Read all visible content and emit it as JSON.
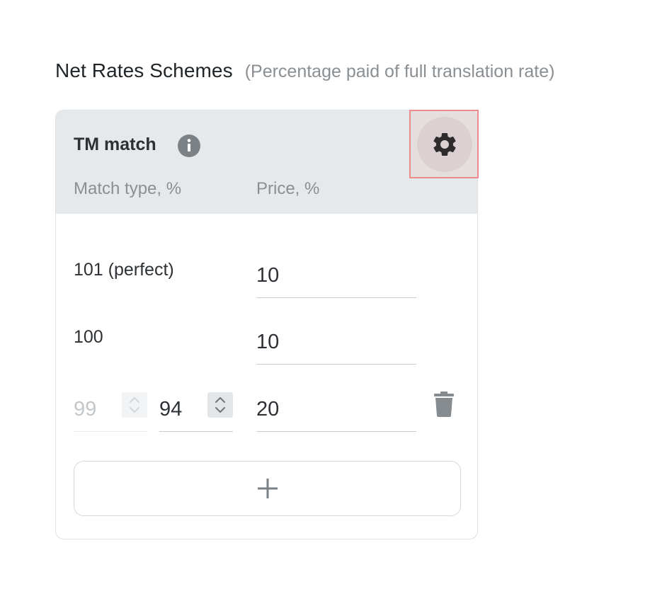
{
  "heading": {
    "title": "Net Rates Schemes",
    "subtitle": "(Percentage paid of full translation rate)"
  },
  "card": {
    "title": "TM match",
    "info_icon": "info-icon",
    "settings_icon": "gear-icon",
    "columns": {
      "match_type": "Match type, %",
      "price": "Price, %"
    },
    "rows": [
      {
        "label": "101 (perfect)",
        "price": "10"
      },
      {
        "label": "100",
        "price": "10"
      },
      {
        "range_from": "99",
        "range_to": "94",
        "price": "20",
        "delete_icon": "trash-icon"
      }
    ],
    "add_icon": "plus-icon"
  },
  "colors": {
    "header_bg": "#e5e9eb",
    "text": "#2d3135",
    "muted": "#8a8f93",
    "highlight": "#ec8a8c"
  }
}
